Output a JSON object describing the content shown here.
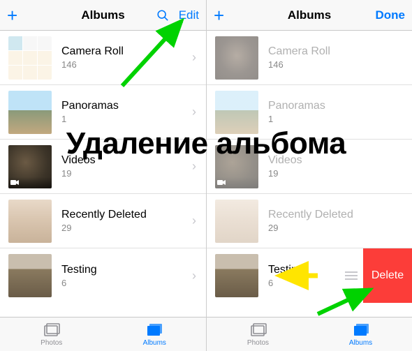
{
  "overlay_caption": "Удаление альбома",
  "left": {
    "header": {
      "title": "Albums",
      "add": "+",
      "edit": "Edit"
    },
    "albums": [
      {
        "name": "Camera Roll",
        "count": "146",
        "thumb": "camera"
      },
      {
        "name": "Panoramas",
        "count": "1",
        "thumb": "pano"
      },
      {
        "name": "Videos",
        "count": "19",
        "thumb": "videos",
        "video": true
      },
      {
        "name": "Recently Deleted",
        "count": "29",
        "thumb": "recent"
      },
      {
        "name": "Testing",
        "count": "6",
        "thumb": "testing"
      }
    ],
    "tabs": {
      "photos": "Photos",
      "albums": "Albums"
    }
  },
  "right": {
    "header": {
      "title": "Albums",
      "add": "+",
      "done": "Done"
    },
    "albums": [
      {
        "name": "Camera Roll",
        "count": "146",
        "thumb": "cat",
        "disabled": true
      },
      {
        "name": "Panoramas",
        "count": "1",
        "thumb": "pano",
        "disabled": true
      },
      {
        "name": "Videos",
        "count": "19",
        "thumb": "videos",
        "video": true,
        "disabled": true
      },
      {
        "name": "Recently Deleted",
        "count": "29",
        "thumb": "recent",
        "disabled": true
      },
      {
        "name": "Testing",
        "count": "6",
        "thumb": "testing",
        "disabled": false,
        "delete": "Delete"
      }
    ],
    "tabs": {
      "photos": "Photos",
      "albums": "Albums"
    }
  }
}
